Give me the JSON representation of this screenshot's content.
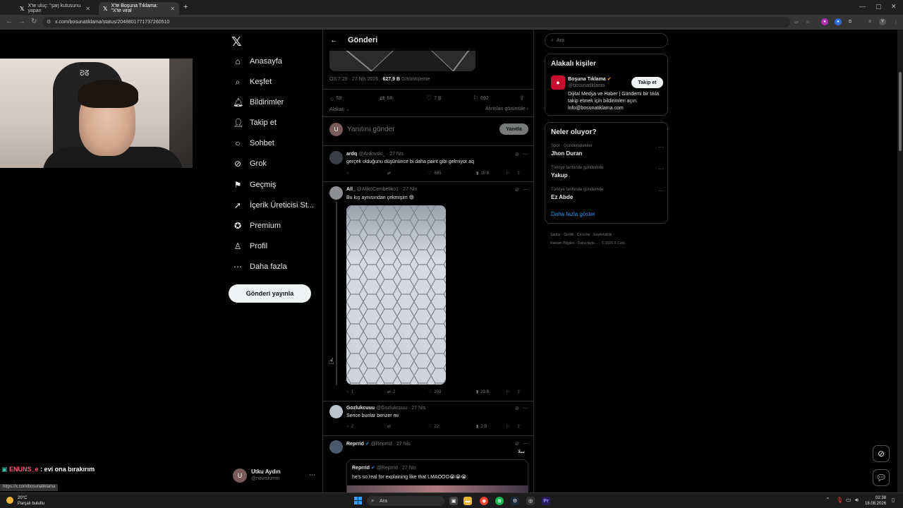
{
  "browser": {
    "tabs": [
      {
        "title": "X'te uluç: \"şarj kutusunu yapan",
        "close": "✕"
      },
      {
        "title": "X'te Boşuna Tıklama: \"X'te viral",
        "close": "✕"
      }
    ],
    "new_tab": "+",
    "url": "x.com/bosunatiklama/status/2048801771737260510",
    "status_url": "https://x.com/bosunatiklama"
  },
  "nav": {
    "items": [
      {
        "label": "Anasayfa",
        "icon": "home-icon",
        "glyph": "⌂"
      },
      {
        "label": "Keşfet",
        "icon": "search-icon",
        "glyph": "⌕"
      },
      {
        "label": "Bildirimler",
        "icon": "bell-icon",
        "glyph": "🔔︎"
      },
      {
        "label": "Takip et",
        "icon": "add-person-icon",
        "glyph": "👤︎"
      },
      {
        "label": "Sohbet",
        "icon": "chat-icon",
        "glyph": "○"
      },
      {
        "label": "Grok",
        "icon": "grok-icon",
        "glyph": "⊘"
      },
      {
        "label": "Geçmiş",
        "icon": "bookmark-icon",
        "glyph": "⚑"
      },
      {
        "label": "İçerik Üreticisi St...",
        "icon": "rocket-icon",
        "glyph": "➚"
      },
      {
        "label": "Premium",
        "icon": "premium-icon",
        "glyph": "✪"
      },
      {
        "label": "Profil",
        "icon": "profile-icon",
        "glyph": "♙"
      },
      {
        "label": "Daha fazla",
        "icon": "more-circle-icon",
        "glyph": "⋯"
      }
    ],
    "post_button": "Gönderi yayınla"
  },
  "account": {
    "name": "Utku Aydın",
    "handle": "@novisiumm",
    "avatar_letter": "U"
  },
  "chat": {
    "user": "ENUNS_e",
    "message": ": evi ona bırakırım"
  },
  "post": {
    "header": "Gönderi",
    "time": "ÖS 7:29 · 27 Nis 2026 · ",
    "views": "627,9 B",
    "views_label": " Görüntüleme",
    "stats": {
      "replies": "59",
      "reposts": "66",
      "likes": "7 B",
      "bookmarks": "692"
    },
    "sort_label": "Alakalı ⌄",
    "quotes_link": "Alıntıları görüntüle ›",
    "reply_placeholder": "Yanıtını gönder",
    "reply_button": "Yanıtla"
  },
  "replies": [
    {
      "name": "ardq",
      "handle": "@Ardovski_ · 27 Nis",
      "text": "gerçek olduğunu düşününce bi daha paint gibi gelmiyor aq",
      "replies": "",
      "reposts": "",
      "likes": "685",
      "views": "19 B"
    },
    {
      "name": "All_",
      "handle": "@AlikoCembeliko1 · 27 Nis",
      "text": "Bu kış aynısından çekmişim 😄",
      "replies": "1",
      "reposts": "2",
      "likes": "259",
      "views": "29 B"
    },
    {
      "name": "Gozlukcuuu",
      "handle": "@Gozlukcuuu · 27 Nis",
      "text": "Sence bunlar benzer mi",
      "replies": "2",
      "reposts": "",
      "likes": "22",
      "views": "2 B"
    },
    {
      "name": "Reprrid",
      "handle": "@Reprrid · 27 Nis",
      "extra": "ﺳﻼ",
      "text": ""
    }
  ],
  "quote": {
    "name": "Reprrid",
    "handle": "@Reprrid · 27 Nis",
    "text": "he's so real for explaining like that LMAOOO😭😭😭"
  },
  "sidebar": {
    "search_placeholder": "Ara",
    "relevant_title": "Alakalı kişiler",
    "person": {
      "name": "Boşuna Tıklama",
      "handle": "@bosunatiklama",
      "bio": "Dijital Medya ve Haber | Gündemi bir tıkla takip etmek için bildirimleri açın. info@bosunatiklama.com",
      "follow": "Takip et"
    },
    "trends_title": "Neler oluyor?",
    "trends": [
      {
        "category": "Spor · Gündemdekiler",
        "title": "Jhon Duran"
      },
      {
        "category": "Türkiye tarihinde gündemde",
        "title": "Yakup"
      },
      {
        "category": "Türkiye tarihinde gündemde",
        "title": "Ez Abde"
      }
    ],
    "show_more": "Daha fazla göster",
    "footer_1": "Şartlar  ·  Gizlilik  ·  Çerezler  ·  Erişilebilirlik  ·",
    "footer_2": "Reklam Bilgileri  ·  Daha fazla ...  ·  © 2026 X Corp."
  },
  "taskbar": {
    "weather_temp": "20°C",
    "weather_desc": "Parçalı bulutlu",
    "search": "Ara",
    "time": "02:38",
    "date": "18.08.2026"
  },
  "colors": {
    "accent": "#1d9bf0",
    "verified": "#1d9bf0",
    "background": "#000000",
    "border": "#2f3336"
  }
}
